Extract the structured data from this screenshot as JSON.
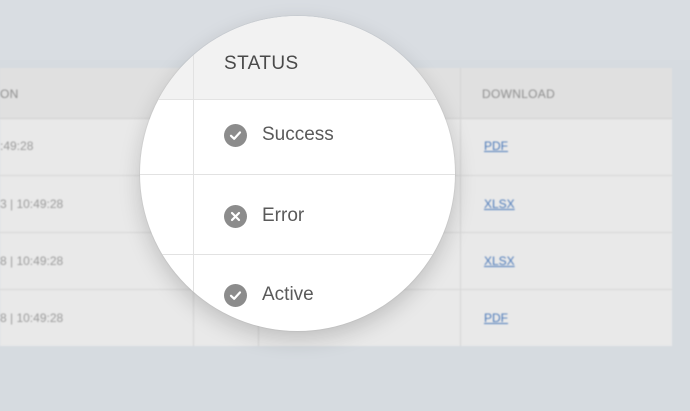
{
  "table": {
    "headers": {
      "left": "ON",
      "download": "DOWNLOAD"
    },
    "rows": [
      {
        "time": ":49:28",
        "download": "PDF"
      },
      {
        "time": "3  |  10:49:28",
        "download": "XLSX"
      },
      {
        "time": "8  |  10:49:28",
        "download": "XLSX"
      },
      {
        "time": "8  |  10:49:28",
        "download": "PDF"
      }
    ]
  },
  "magnifier": {
    "header": "STATUS",
    "items": [
      {
        "label": "Success",
        "icon": "check-circle-icon"
      },
      {
        "label": "Error",
        "icon": "x-circle-icon"
      },
      {
        "label": "Active",
        "icon": "check-circle-icon"
      }
    ]
  },
  "colors": {
    "background": "#d6dbe0",
    "table": "#e9e9e9",
    "link": "#4a78b8",
    "icon": "#8c8c8c",
    "lens": "#ffffff"
  }
}
